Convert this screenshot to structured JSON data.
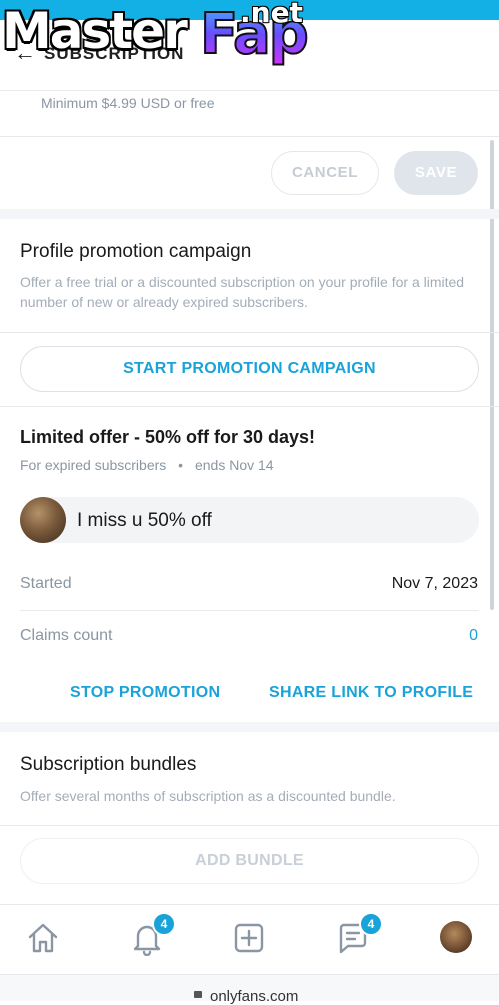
{
  "watermark": {
    "part1": "Master",
    "part2": "Fap",
    "part3": ".net"
  },
  "header": {
    "back_icon": "arrow-left-icon",
    "title": "SUBSCRIPTION"
  },
  "price": {
    "minimum_text": "Minimum $4.99 USD or free"
  },
  "actions": {
    "cancel_label": "CANCEL",
    "save_label": "SAVE"
  },
  "promotion": {
    "title": "Profile promotion campaign",
    "description": "Offer a free trial or a discounted subscription on your profile for a limited number of new or already expired subscribers.",
    "start_label": "START PROMOTION CAMPAIGN"
  },
  "offer": {
    "title": "Limited offer - 50% off for 30 days!",
    "audience": "For expired subscribers",
    "separator": "•",
    "ends": "ends Nov 14",
    "message": "I miss u 50% off",
    "started_label": "Started",
    "started_value": "Nov 7, 2023",
    "claims_label": "Claims count",
    "claims_value": "0",
    "stop_label": "STOP PROMOTION",
    "share_label": "SHARE LINK TO PROFILE"
  },
  "bundles": {
    "title": "Subscription bundles",
    "description": "Offer several months of subscription as a discounted bundle.",
    "add_label": "ADD BUNDLE"
  },
  "nav": {
    "items": [
      {
        "icon": "home-icon"
      },
      {
        "icon": "bell-icon",
        "badge": "4"
      },
      {
        "icon": "add-post-icon"
      },
      {
        "icon": "messages-icon",
        "badge": "4"
      },
      {
        "icon": "profile-avatar"
      }
    ]
  },
  "browser": {
    "url": "onlyfans.com"
  },
  "colors": {
    "accent": "#1aa3d9",
    "topbar": "#13b0e6",
    "muted": "#8a96a3"
  }
}
